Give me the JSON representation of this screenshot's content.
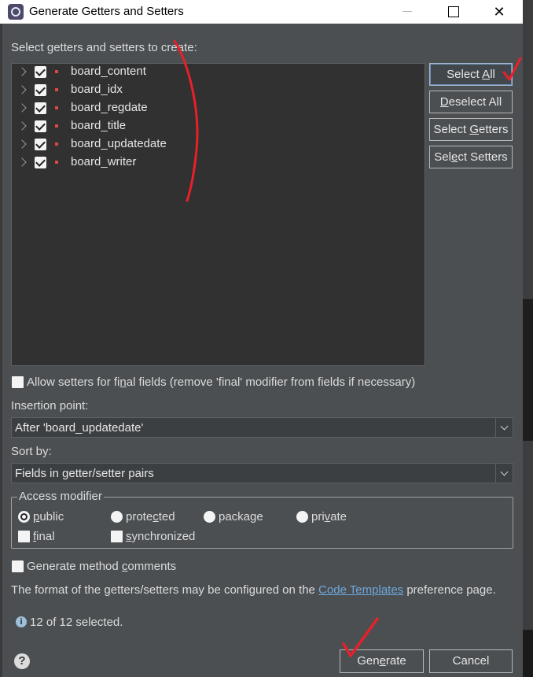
{
  "window": {
    "title": "Generate Getters and Setters"
  },
  "dialog": {
    "select_label": "Select getters and setters to create:",
    "fields": [
      {
        "name": "board_content",
        "checked": true
      },
      {
        "name": "board_idx",
        "checked": true
      },
      {
        "name": "board_regdate",
        "checked": true
      },
      {
        "name": "board_title",
        "checked": true
      },
      {
        "name": "board_updatedate",
        "checked": true
      },
      {
        "name": "board_writer",
        "checked": true
      }
    ],
    "buttons": {
      "select_all": {
        "pre": "Select ",
        "u": "A",
        "post": "ll"
      },
      "deselect_all": {
        "pre": "",
        "u": "D",
        "post": "eselect All"
      },
      "select_getters": {
        "pre": "Select ",
        "u": "G",
        "post": "etters"
      },
      "select_setters": {
        "pre": "Sel",
        "u": "e",
        "post": "ct Setters"
      }
    },
    "allow_final": {
      "pre": "Allow setters for fi",
      "u": "n",
      "post": "al fields (remove 'final' modifier from fields if necessary)",
      "checked": false
    },
    "insertion_label": "Insertion point:",
    "insertion_value": "After 'board_updatedate'",
    "sort_label": "Sort by:",
    "sort_value": "Fields in getter/setter pairs",
    "access_legend": "Access modifier",
    "access": {
      "public": {
        "pre": "",
        "u": "p",
        "post": "ublic",
        "selected": true
      },
      "protected": {
        "pre": "prote",
        "u": "c",
        "post": "ted",
        "selected": false
      },
      "package": {
        "pre": "packa",
        "u": "g",
        "post": "e",
        "selected": false
      },
      "private": {
        "pre": "pri",
        "u": "v",
        "post": "ate",
        "selected": false
      }
    },
    "final_cb": {
      "pre": "",
      "u": "f",
      "post": "inal",
      "checked": false
    },
    "synchronized_cb": {
      "pre": "",
      "u": "s",
      "post": "ynchronized",
      "checked": false
    },
    "gen_comments": {
      "pre": "Generate method ",
      "u": "c",
      "post": "omments",
      "checked": false
    },
    "format_text_pre": "The format of the getters/setters may be configured on the ",
    "format_link": "Code Templates",
    "format_text_post": " preference page.",
    "status": "12 of 12 selected.",
    "generate": {
      "pre": "Gen",
      "u": "e",
      "post": "rate"
    },
    "cancel": "Cancel"
  },
  "icons": {
    "app": "eclipse-icon",
    "info": "info-icon",
    "help": "help-icon"
  },
  "colors": {
    "dialog_bg": "#4b4f52",
    "tree_bg": "#313131",
    "annotation": "#e8202a",
    "link": "#6fa8dc"
  }
}
